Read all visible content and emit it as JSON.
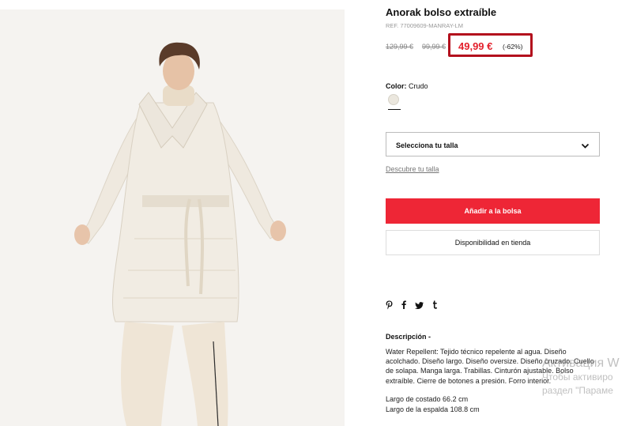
{
  "product": {
    "title": "Anorak bolso extraíble",
    "ref": "REF. 77009609-MANRAY-LM",
    "original_price": "129,99 €",
    "previous_price": "99,99 €",
    "current_price": "49,99 €",
    "discount": "(-62%)",
    "price_color": "#e3202c",
    "highlight_color": "#b3101d"
  },
  "color": {
    "label": "Color:",
    "value": "Crudo",
    "swatch_hex": "#ebe7de"
  },
  "size": {
    "select_label": "Selecciona tu talla",
    "guide_link": "Descubre tu talla"
  },
  "actions": {
    "add_to_bag": "Añadir a la bolsa",
    "add_to_bag_color": "#ee2636",
    "store_availability": "Disponibilidad en tienda"
  },
  "share": {
    "icons": [
      "pinterest-icon",
      "facebook-icon",
      "twitter-icon",
      "tumblr-icon"
    ]
  },
  "description": {
    "heading": "Descripción -",
    "text": "Water Repellent: Tejido técnico repelente al agua. Diseño acolchado. Diseño largo. Diseño oversize. Diseño cruzado. Cuello de solapa. Manga larga. Trabillas. Cinturón ajustable. Bolso extraíble. Cierre de botones a presión. Forro interior.",
    "measurements": [
      "Largo de costado 66.2 cm",
      "Largo de la espalda 108.8 cm"
    ]
  },
  "watermark": {
    "line1": "Активация W",
    "line2": "Чтобы активиро",
    "line3": "раздел \"Параме"
  }
}
